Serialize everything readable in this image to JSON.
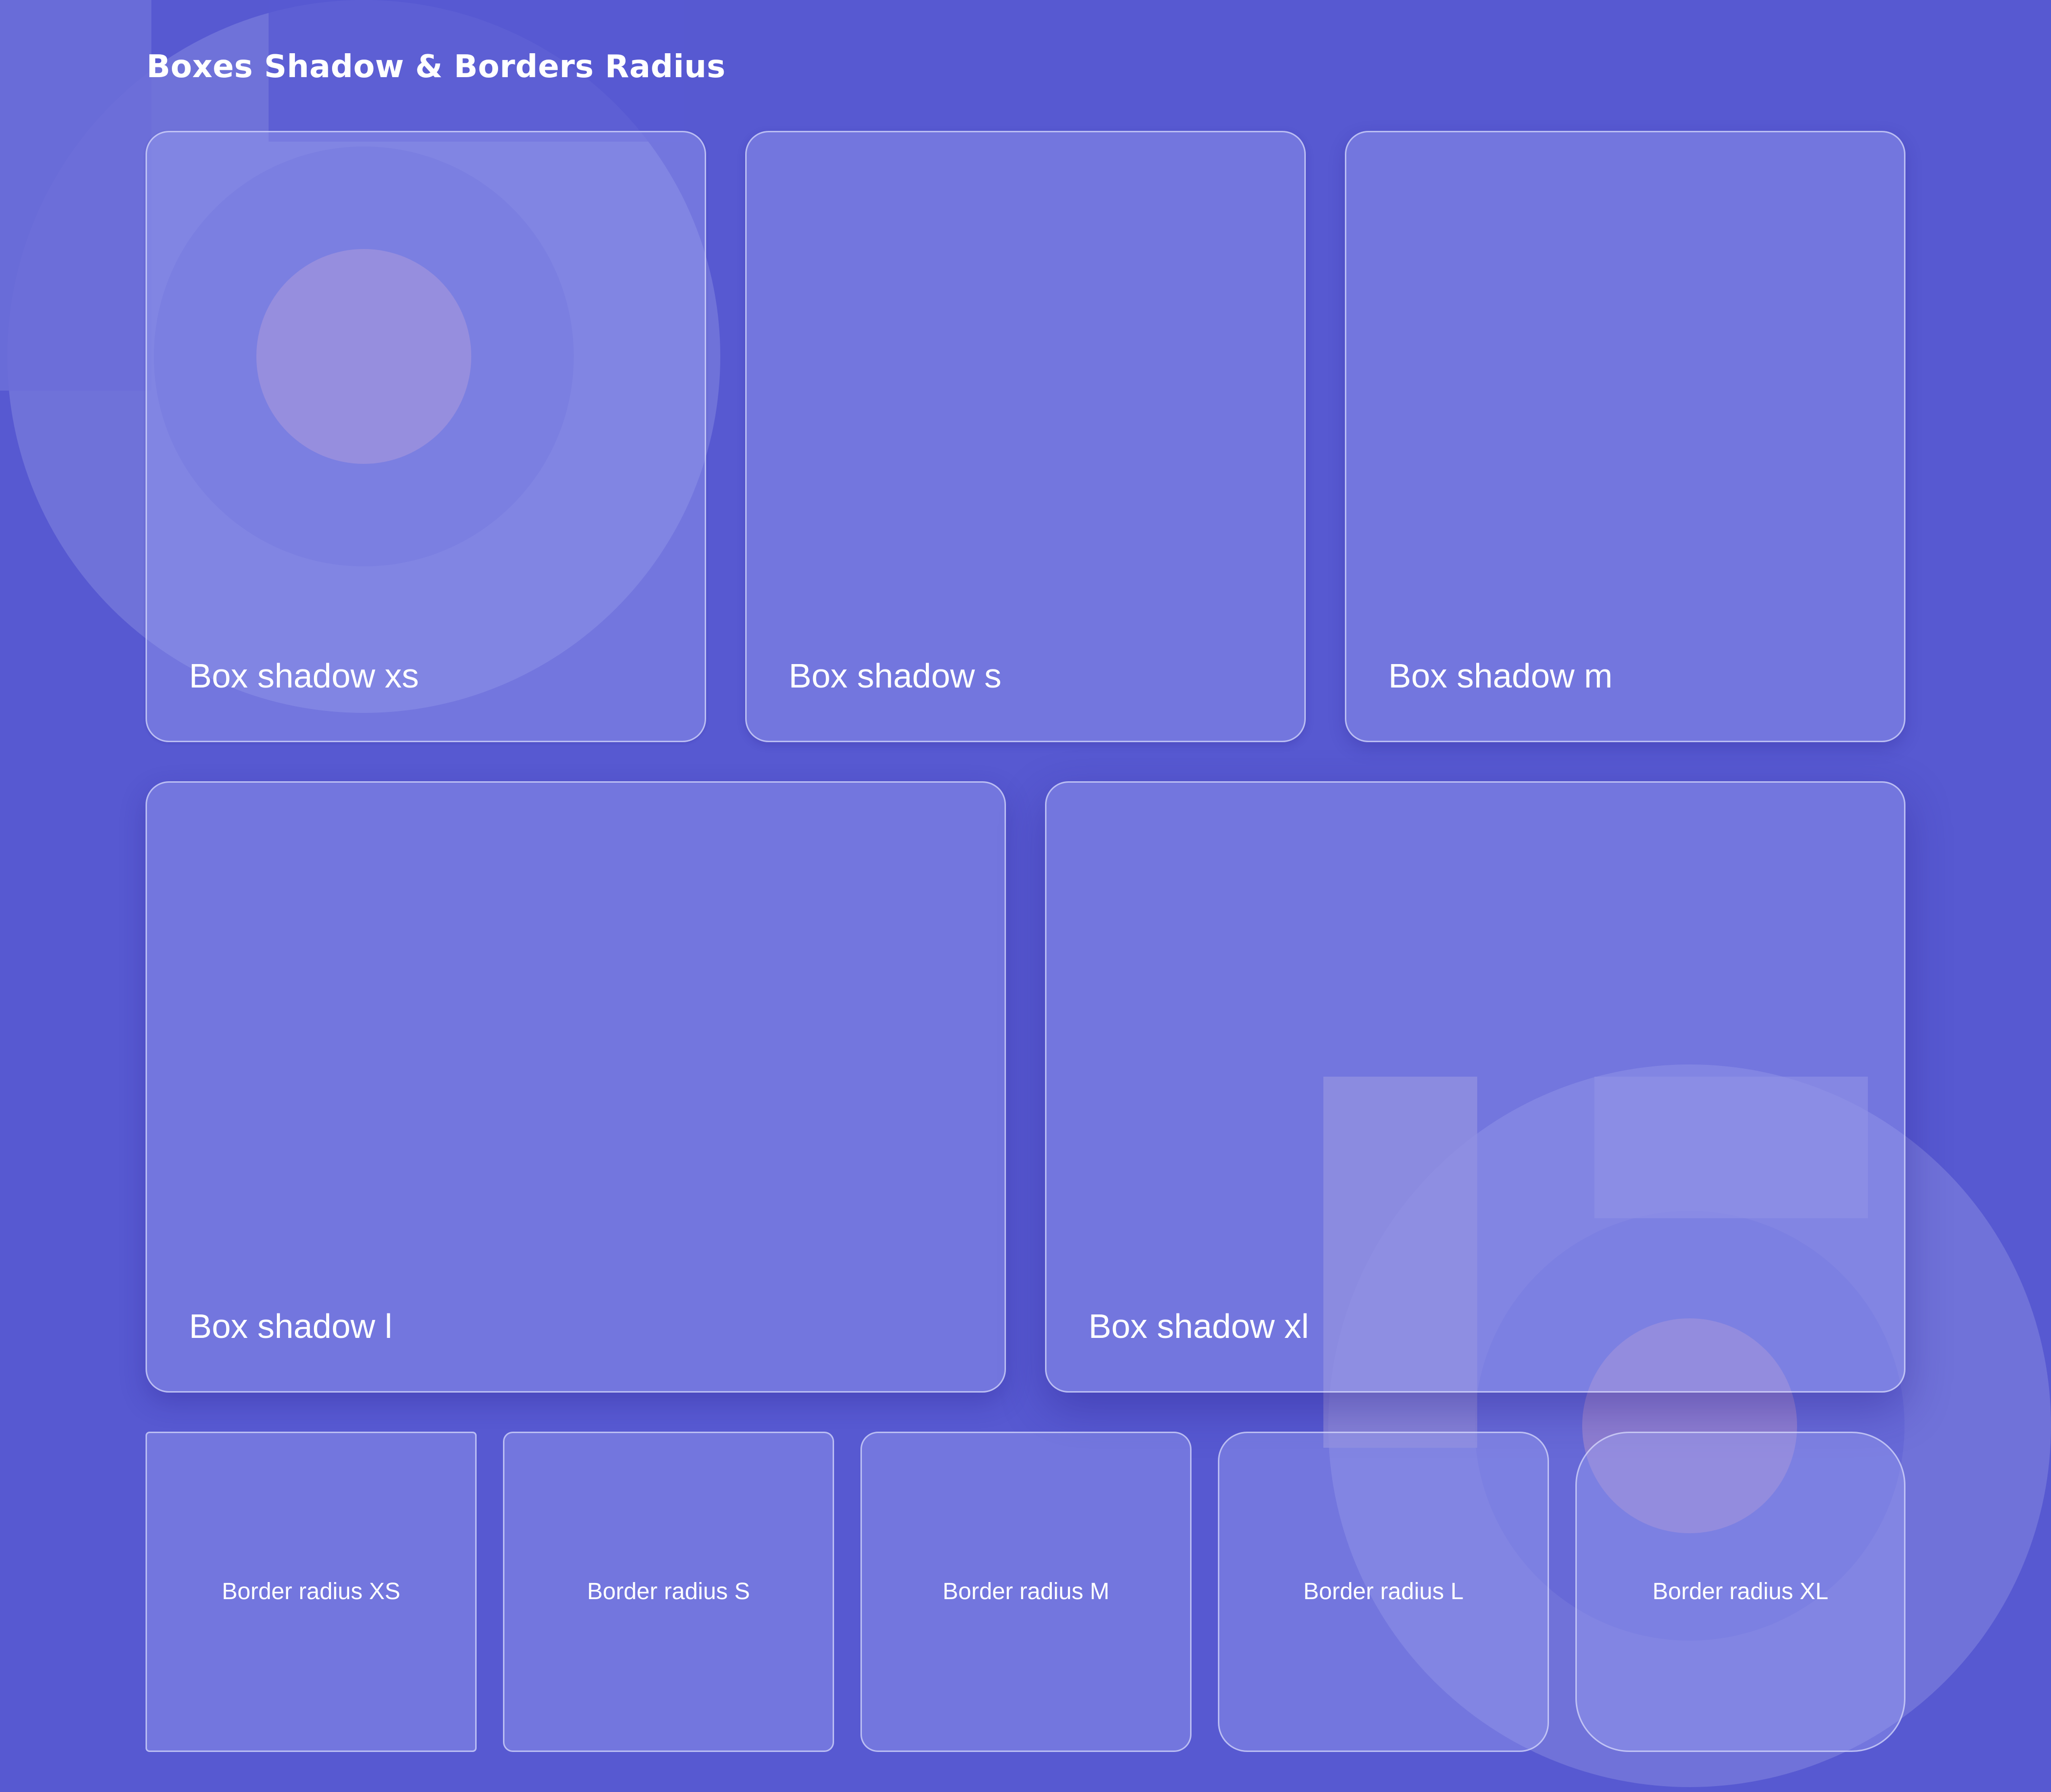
{
  "page": {
    "title": "Boxes Shadow & Borders Radius",
    "background_color": "#5759d1",
    "card_color": "#7a7cdd"
  },
  "shadow_boxes": [
    {
      "label": "Box shadow xs"
    },
    {
      "label": "Box shadow s"
    },
    {
      "label": "Box shadow m"
    },
    {
      "label": "Box shadow l"
    },
    {
      "label": "Box shadow xl"
    }
  ],
  "radius_boxes": [
    {
      "label": "Border radius XS"
    },
    {
      "label": "Border radius S"
    },
    {
      "label": "Border radius M"
    },
    {
      "label": "Border radius L"
    },
    {
      "label": "Border radius XL"
    }
  ],
  "decoration": {
    "logo_color": "#8d90e0",
    "dot_color": "#9b86cf"
  }
}
